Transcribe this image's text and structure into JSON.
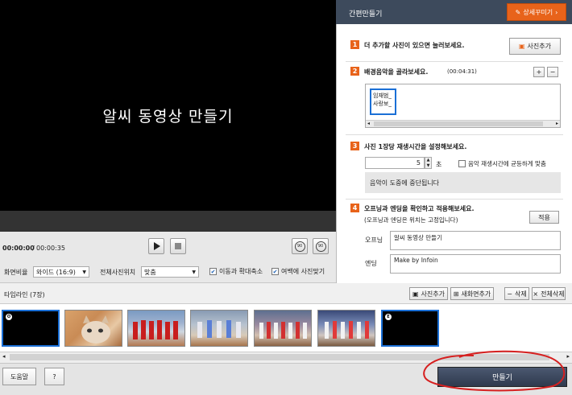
{
  "video": {
    "title": "알씨 동영상 만들기"
  },
  "playback": {
    "current_time": "00:00:00",
    "total_time": "00:00:35"
  },
  "controls": {
    "ratio_label": "화면비율",
    "ratio_value": "와이드 (16:9)",
    "position_label": "전체사진위치",
    "position_value": "맞춤",
    "move_zoom_label": "이동과 확대축소",
    "margin_fit_label": "여백에 사진맞기",
    "rotate_left": "90",
    "rotate_right": "90"
  },
  "panel": {
    "title": "간편만들기",
    "detail_button": "상세꾸미기",
    "step1": {
      "num": "1",
      "text": "더 추가할 사진이 있으면 눌러보세요.",
      "button": "사진추가"
    },
    "step2": {
      "num": "2",
      "text": "배경음악을 골라보세요.",
      "duration": "(00:04:31)",
      "add": "+",
      "remove": "−",
      "music_name_line1": "임재범_",
      "music_name_line2": "사랑보_"
    },
    "step3": {
      "num": "3",
      "text": "사진 1장당 재생시간을 설정해보세요.",
      "seconds_value": "5",
      "seconds_unit": "초",
      "fit_music_label": "음악 재생시간에 균등하게 맞춤",
      "notice": "음악이 도중에 중단됩니다"
    },
    "step4": {
      "num": "4",
      "text": "오프닝과 엔딩을 확인하고 적용해보세요.",
      "subtext": "(오프닝과 엔딩은 위치는 고정입니다)",
      "apply_button": "적용",
      "opening_label": "오프닝",
      "opening_value": "알씨 동영상 만들기",
      "ending_label": "엔딩",
      "ending_value": "Make by Infoin"
    }
  },
  "timeline": {
    "title": "타임라인 (7장)",
    "add_photo": "사진추가",
    "add_new_screen": "새화면추가",
    "delete": "삭제",
    "delete_all": "전체삭제",
    "opening_badge": "O",
    "ending_badge": "E"
  },
  "bottom": {
    "help": "도움말",
    "question": "?",
    "make": "만들기"
  },
  "colors": {
    "accent": "#e8631a",
    "panel_header": "#3d4a5c",
    "make_button": "#3a465c",
    "selection": "#1a6fd6"
  }
}
